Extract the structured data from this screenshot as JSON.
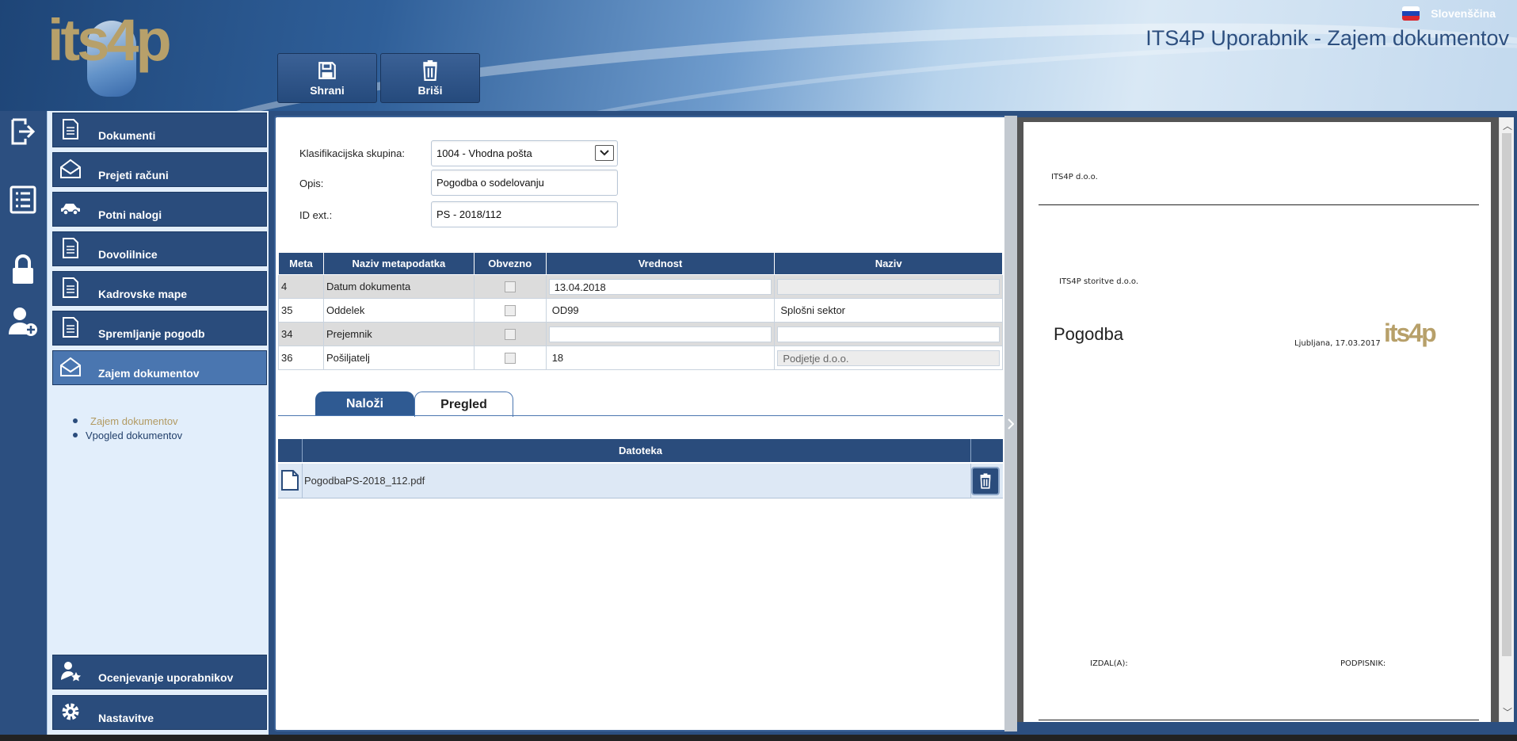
{
  "header": {
    "app_title": "ITS4P Uporabnik - Zajem dokumentov",
    "language": "Slovenščina",
    "logo_text": "its4p"
  },
  "toolbar": {
    "save_label": "Shrani",
    "delete_label": "Briši"
  },
  "sidebar": {
    "items": [
      {
        "label": "Dokumenti",
        "icon": "document-icon"
      },
      {
        "label": "Prejeti računi",
        "icon": "envelope-icon"
      },
      {
        "label": "Potni nalogi",
        "icon": "car-icon"
      },
      {
        "label": "Dovolilnice",
        "icon": "document-icon"
      },
      {
        "label": "Kadrovske mape",
        "icon": "document-icon"
      },
      {
        "label": "Spremljanje pogodb",
        "icon": "document-icon"
      },
      {
        "label": "Zajem dokumentov",
        "icon": "envelope-icon",
        "active": true
      }
    ],
    "subitems": [
      "Zajem dokumentov",
      "Vpogled dokumentov"
    ],
    "bottom_items": [
      {
        "label": "Ocenjevanje uporabnikov",
        "icon": "user-star-icon"
      },
      {
        "label": "Nastavitve",
        "icon": "gear-icon"
      }
    ]
  },
  "form": {
    "klasifikacija_label": "Klasifikacijska skupina:",
    "klasifikacija_value": "1004 - Vhodna pošta",
    "opis_label": "Opis:",
    "opis_value": "Pogodba o sodelovanju",
    "idext_label": "ID ext.:",
    "idext_value": "PS - 2018/112"
  },
  "meta_table": {
    "headers": [
      "Meta",
      "Naziv metapodatka",
      "Obvezno",
      "Vrednost",
      "Naziv"
    ],
    "rows": [
      {
        "meta": "4",
        "naziv": "Datum dokumenta",
        "vrednost": "13.04.2018",
        "naziv2": ""
      },
      {
        "meta": "35",
        "naziv": "Oddelek",
        "vrednost": "OD99",
        "naziv2": "Splošni sektor"
      },
      {
        "meta": "34",
        "naziv": "Prejemnik",
        "vrednost": "",
        "naziv2": ""
      },
      {
        "meta": "36",
        "naziv": "Pošiljatelj",
        "vrednost": "18",
        "naziv2": "Podjetje d.o.o."
      }
    ]
  },
  "tabs": {
    "nalozi": "Naloži",
    "pregled": "Pregled"
  },
  "files": {
    "header": "Datoteka",
    "rows": [
      {
        "name": "PogodbaPS-2018_112.pdf"
      }
    ]
  },
  "preview": {
    "company": "ITS4P d.o.o.",
    "company_full": "ITS4P storitve d.o.o.",
    "title": "Pogodba",
    "date": "Ljubljana, 17.03.2017",
    "logo_text": "its4p",
    "izdal": "IZDAL(A):",
    "podpisnik": "PODPISNIK:"
  },
  "colors": {
    "nav_bg": "#2a4c7c",
    "nav_active": "#4a76b0",
    "accent_gold": "#b7a06a",
    "sidebar_bg": "#e2eefb"
  }
}
